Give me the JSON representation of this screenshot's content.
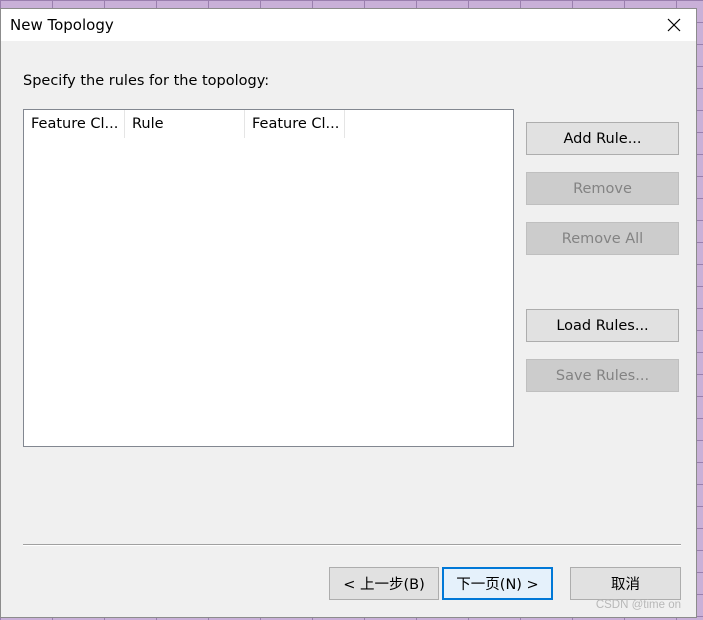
{
  "window": {
    "title": "New Topology",
    "close_icon": "close-icon"
  },
  "instruction": "Specify the rules for the topology:",
  "rules_list": {
    "columns": [
      "Feature Cl...",
      "Rule",
      "Feature Cl..."
    ],
    "rows": []
  },
  "side_buttons": {
    "add_rule": "Add Rule...",
    "remove": "Remove",
    "remove_all": "Remove All",
    "load_rules": "Load Rules...",
    "save_rules": "Save Rules..."
  },
  "footer_buttons": {
    "back": "< 上一步(B)",
    "next": "下一页(N) >",
    "cancel": "取消"
  },
  "watermark": "CSDN @time on",
  "colors": {
    "accent": "#0078d7",
    "dialog_bg": "#f0f0f0",
    "disabled_text": "#838383"
  }
}
